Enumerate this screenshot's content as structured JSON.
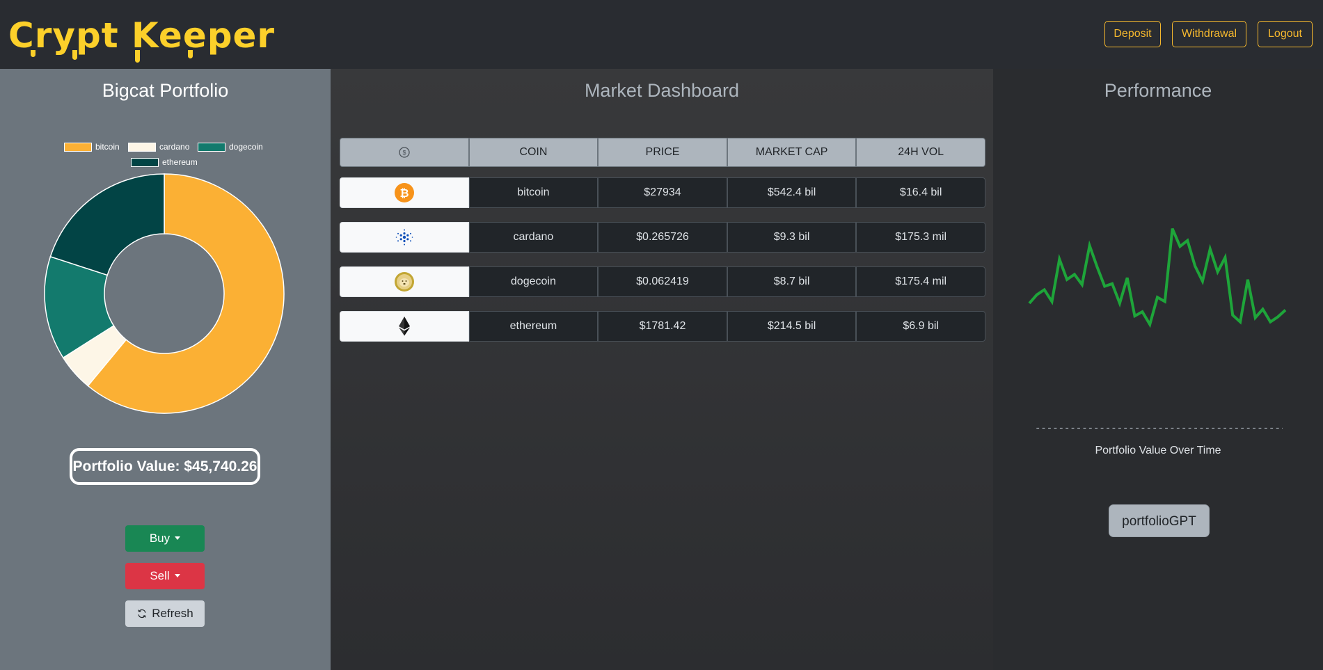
{
  "app": {
    "logo_text": "Crypt Keeper"
  },
  "header": {
    "deposit": "Deposit",
    "withdrawal": "Withdrawal",
    "logout": "Logout"
  },
  "portfolio": {
    "title": "Bigcat Portfolio",
    "value_label": "Portfolio Value: $45,740.26",
    "buy": "Buy",
    "sell": "Sell",
    "refresh": "Refresh",
    "chart_data": {
      "type": "pie",
      "categories": [
        "bitcoin",
        "cardano",
        "dogecoin",
        "ethereum"
      ],
      "values": [
        61,
        5,
        14,
        20
      ],
      "colors": [
        "#fbb034",
        "#fdf6e7",
        "#137a6d",
        "#024445"
      ],
      "legend": "top"
    }
  },
  "market": {
    "title": "Market Dashboard",
    "headers": [
      "COIN",
      "PRICE",
      "MARKET CAP",
      "24H VOL"
    ],
    "header_icon": "dollar-coin-icon",
    "rows": [
      {
        "icon": "bitcoin-icon",
        "coin": "bitcoin",
        "price": "$27934",
        "cap": "$542.4 bil",
        "vol": "$16.4 bil"
      },
      {
        "icon": "cardano-icon",
        "coin": "cardano",
        "price": "$0.265726",
        "cap": "$9.3 bil",
        "vol": "$175.3 mil"
      },
      {
        "icon": "dogecoin-icon",
        "coin": "dogecoin",
        "price": "$0.062419",
        "cap": "$8.7 bil",
        "vol": "$175.4 mil"
      },
      {
        "icon": "ethereum-icon",
        "coin": "ethereum",
        "price": "$1781.42",
        "cap": "$214.5 bil",
        "vol": "$6.9 bil"
      }
    ]
  },
  "performance": {
    "title": "Performance",
    "axis_dashes": "------------------------------------------------",
    "caption": "Portfolio Value Over Time",
    "gpt_button": "portfolioGPT",
    "line_color": "#1ea53a",
    "chart_data": {
      "type": "line",
      "title": "Portfolio Value Over Time",
      "series": [
        {
          "values": [
            60,
            70,
            76,
            62,
            112,
            88,
            94,
            82,
            128,
            103,
            80,
            83,
            60,
            90,
            45,
            50,
            35,
            67,
            62,
            148,
            127,
            134,
            104,
            86,
            124,
            97,
            114,
            46,
            38,
            88,
            43,
            53,
            38,
            44,
            52
          ]
        }
      ]
    }
  }
}
